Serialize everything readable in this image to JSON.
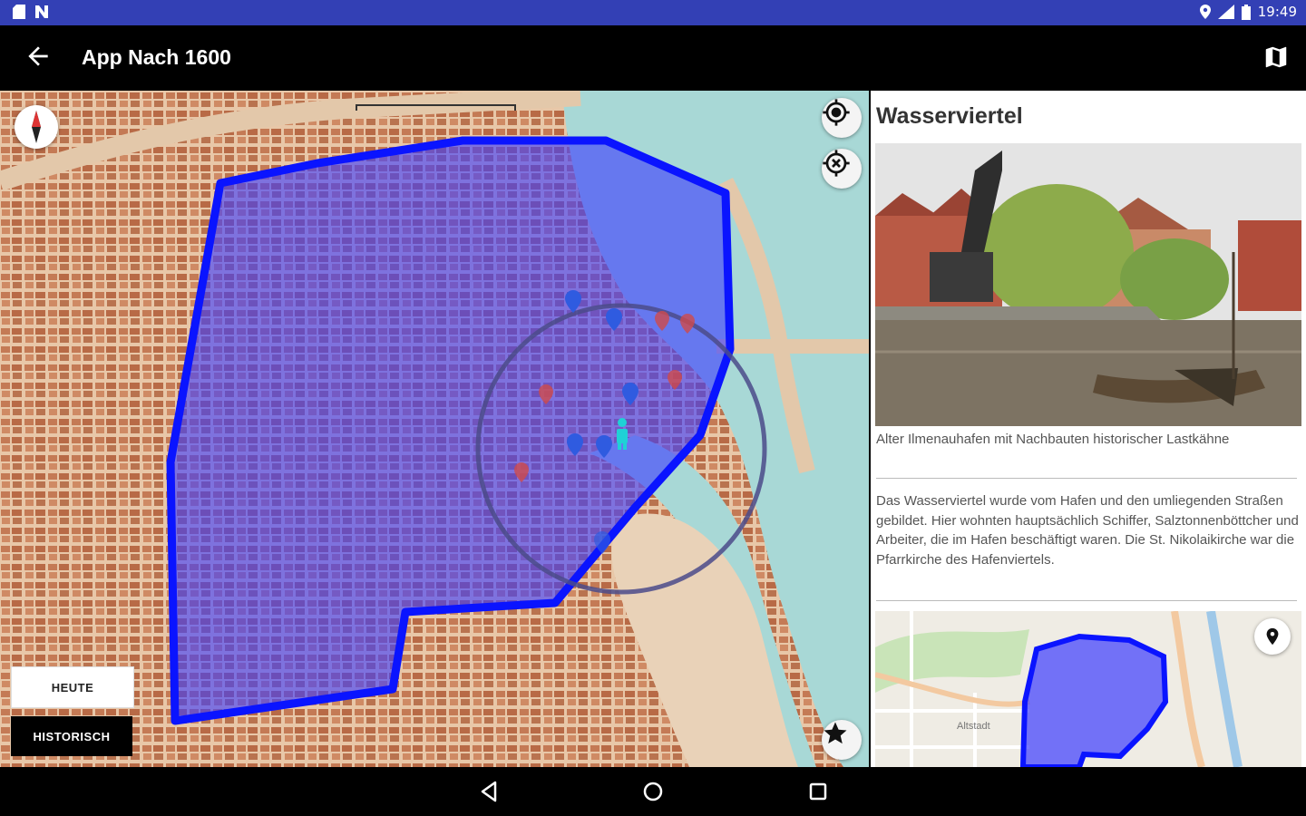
{
  "status_bar": {
    "time": "19:49",
    "icons": [
      "sd-card-icon",
      "n-icon",
      "location-icon",
      "signal-icon",
      "battery-icon"
    ]
  },
  "app_bar": {
    "title": "App Nach 1600",
    "back_icon": "arrow-back-icon",
    "map_icon": "map-icon"
  },
  "map": {
    "layer_buttons": {
      "today": "HEUTE",
      "historic": "HISTORISCH"
    },
    "controls": [
      "compass-icon",
      "my-location-icon",
      "close-circle-icon",
      "star-icon"
    ],
    "colors": {
      "district_fill": "#3d3dff",
      "district_stroke": "#0a14ff",
      "water": "#a8d8d6",
      "pin_blue": "#2f5be0",
      "pin_red": "#d04a4a"
    }
  },
  "detail": {
    "title": "Wasserviertel",
    "caption": "Alter Ilmenauhafen mit Nachbauten historischer Lastkähne",
    "description": "Das Wasserviertel wurde vom Hafen und den umliegenden Straßen gebildet. Hier wohnten hauptsächlich Schiffer, Salztonnenböttcher und Arbeiter, die im Hafen beschäftigt waren. Die St. Nikolaikirche war die Pfarrkirche des Hafenviertels.",
    "minimap_label": "Altstadt"
  }
}
